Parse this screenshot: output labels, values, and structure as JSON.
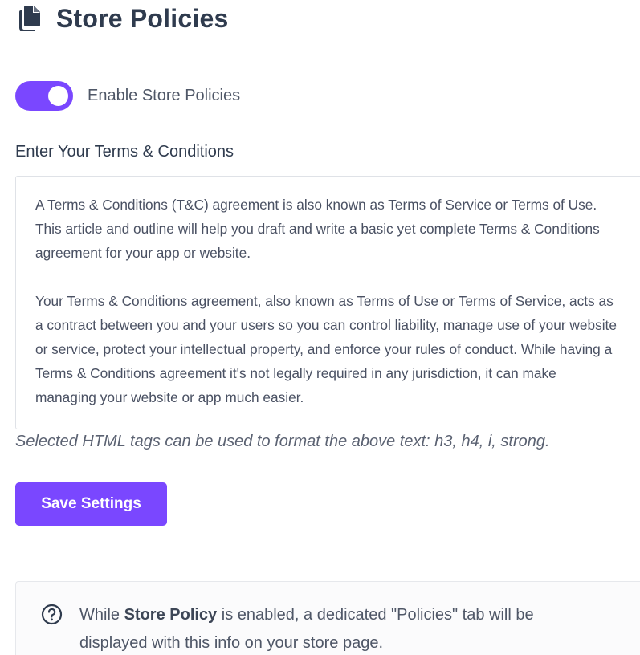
{
  "header": {
    "title": "Store Policies",
    "icon": "copy-document-icon"
  },
  "toggle": {
    "label": "Enable Store Policies",
    "enabled": true,
    "color": "#7a47ff"
  },
  "terms": {
    "label": "Enter Your Terms & Conditions",
    "paragraphs": [
      "A Terms & Conditions (T&C) agreement is also known as Terms of Service or Terms of Use. This article and outline will help you draft and write a basic yet complete Terms & Conditions agreement for your app or website.",
      "Your Terms & Conditions agreement, also known as Terms of Use or Terms of Service, acts as a contract between you and your users so you can control liability, manage use of your website or service, protect your intellectual property, and enforce your rules of conduct. While having a Terms & Conditions agreement it's not legally required in any jurisdiction, it can make managing your website or app much easier."
    ],
    "hint": "Selected HTML tags can be used to format the above text: h3, h4, i, strong."
  },
  "actions": {
    "save_label": "Save Settings"
  },
  "info": {
    "icon": "question-circle-icon",
    "text_before": "While ",
    "text_bold": "Store Policy",
    "text_after": " is enabled, a dedicated \"Policies\" tab will be displayed with this info on your store page."
  },
  "colors": {
    "accent": "#7a47ff",
    "title": "#2f3b4e",
    "border": "#dfe2e7"
  }
}
